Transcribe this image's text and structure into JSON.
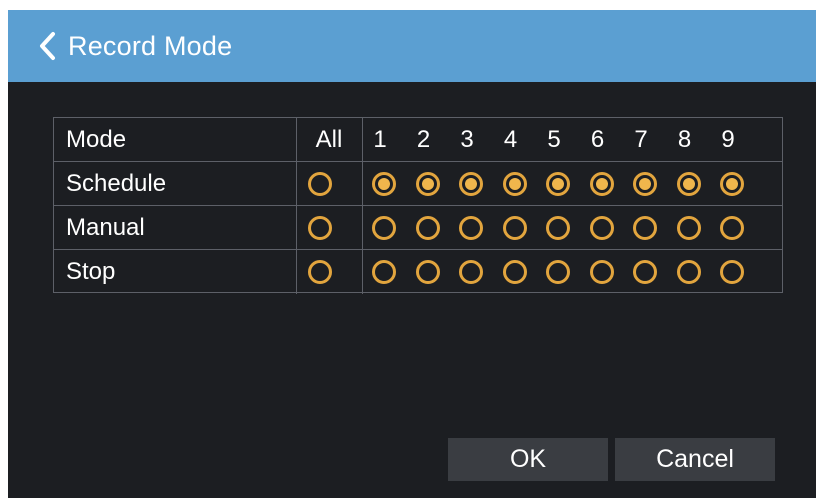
{
  "title_bar": {
    "title": "Record Mode",
    "back_icon": "chevron-left-icon"
  },
  "grid": {
    "header": {
      "mode_label": "Mode",
      "all_label": "All",
      "channels": [
        "1",
        "2",
        "3",
        "4",
        "5",
        "6",
        "7",
        "8",
        "9"
      ]
    },
    "rows": [
      {
        "key": "schedule",
        "label": "Schedule",
        "all_selected": false,
        "selected": [
          true,
          true,
          true,
          true,
          true,
          true,
          true,
          true,
          true
        ]
      },
      {
        "key": "manual",
        "label": "Manual",
        "all_selected": false,
        "selected": [
          false,
          false,
          false,
          false,
          false,
          false,
          false,
          false,
          false
        ]
      },
      {
        "key": "stop",
        "label": "Stop",
        "all_selected": false,
        "selected": [
          false,
          false,
          false,
          false,
          false,
          false,
          false,
          false,
          false
        ]
      }
    ]
  },
  "buttons": {
    "ok_label": "OK",
    "cancel_label": "Cancel"
  },
  "colors": {
    "title_bar": "#5b9fd2",
    "background": "#1c1e22",
    "radio_accent": "#e2a53e",
    "button_bg": "#3a3d42",
    "grid_line": "#5d6068"
  }
}
